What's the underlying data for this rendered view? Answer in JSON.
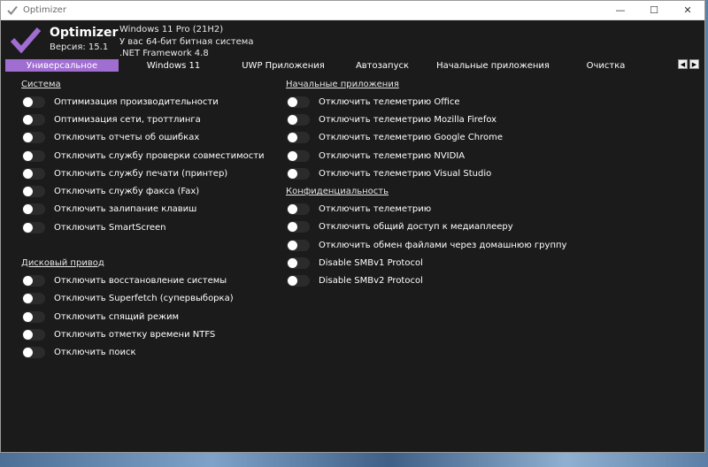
{
  "window": {
    "title": "Optimizer",
    "controls": {
      "minimize": "—",
      "maximize": "☐",
      "close": "✕"
    }
  },
  "header": {
    "app_name": "Optimizer",
    "version": "Версия: 15.1",
    "sysinfo": [
      "Windows 11 Pro (21H2)",
      "У вас 64-бит битная система",
      ".NET Framework 4.8"
    ]
  },
  "tabs": [
    {
      "label": "Универсальное",
      "active": true
    },
    {
      "label": "Windows 11"
    },
    {
      "label": "UWP Приложения"
    },
    {
      "label": "Автозапуск"
    },
    {
      "label": "Начальные приложения"
    },
    {
      "label": "Очистка"
    }
  ],
  "tab_arrows": {
    "left": "◀",
    "right": "▶"
  },
  "sections": {
    "system": {
      "title": "Система",
      "items": [
        "Оптимизация производительности",
        "Оптимизация сети, троттлинга",
        "Отключить отчеты об ошибках",
        "Отключить службу проверки совместимости",
        "Отключить службу печати (принтер)",
        "Отключить службу факса (Fax)",
        "Отключить залипание клавиш",
        "Отключить SmartScreen"
      ]
    },
    "disk": {
      "title": "Дисковый привод",
      "items": [
        "Отключить восстановление системы",
        "Отключить Superfetch (супервыборка)",
        "Отключить спящий режим",
        "Отключить отметку времени NTFS",
        "Отключить поиск"
      ]
    },
    "startup_apps": {
      "title": "Начальные приложения",
      "items": [
        "Отключить телеметрию Office",
        "Отключить телеметрию Mozilla Firefox",
        "Отключить телеметрию Google Chrome",
        "Отключить телеметрию NVIDIA",
        "Отключить телеметрию Visual Studio"
      ]
    },
    "privacy": {
      "title": "Конфиденциальность",
      "items": [
        "Отключить телеметрию",
        "Отключить общий доступ к медиаплееру",
        "Отключить обмен файлами через домашнюю группу",
        "Disable SMBv1 Protocol",
        "Disable SMBv2 Protocol"
      ]
    }
  },
  "colors": {
    "accent": "#a06dd1",
    "background": "#1b1b1b",
    "toggle_off": "#2b2b2b"
  }
}
